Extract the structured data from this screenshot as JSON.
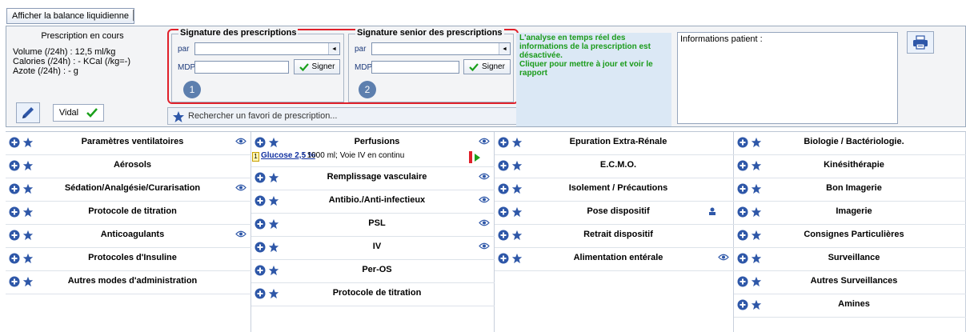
{
  "toolbar": {
    "balance_button": "Afficher la balance liquidienne"
  },
  "prescription": {
    "title": "Prescription en cours",
    "volume": "Volume (/24h) : 12,5 ml/kg",
    "calories": "Calories (/24h) : - KCal (/kg=-)",
    "azote": "Azote (/24h) : - g",
    "vidal_label": "Vidal"
  },
  "signature": {
    "title": "Signature des prescriptions",
    "par_label": "par",
    "par_value": "",
    "mdp_label": "MDP",
    "mdp_value": "",
    "signer_label": "Signer",
    "badge": "1"
  },
  "signature_senior": {
    "title": "Signature senior des prescriptions",
    "par_label": "par",
    "par_value": "",
    "mdp_label": "MDP",
    "mdp_value": "",
    "signer_label": "Signer",
    "badge": "2"
  },
  "favorite_search": {
    "placeholder": "Rechercher un favori de prescription..."
  },
  "analysis": {
    "line1": "L'analyse en temps réel des informations de la prescription est désactivée.",
    "line2": "Cliquer pour mettre à jour et voir le rapport"
  },
  "patient_info": {
    "label": "Informations patient :"
  },
  "columns": [
    {
      "rows": [
        {
          "title": "Paramètres ventilatoires",
          "eye": true
        },
        {
          "title": "Aérosols",
          "eye": false
        },
        {
          "title": "Sédation/Analgésie/Curarisation",
          "eye": true
        },
        {
          "title": "Protocole de titration",
          "eye": false
        },
        {
          "title": "Anticoagulants",
          "eye": true
        },
        {
          "title": "Protocoles d'Insuline",
          "eye": false
        },
        {
          "title": "Autres modes d'administration",
          "eye": false
        }
      ]
    },
    {
      "rows": [
        {
          "title": "Perfusions",
          "eye": true
        },
        {
          "title": "Remplissage vasculaire",
          "eye": true
        },
        {
          "title": "Antibio./Anti-infectieux",
          "eye": true
        },
        {
          "title": "PSL",
          "eye": true
        },
        {
          "title": "IV",
          "eye": true
        },
        {
          "title": "Per-OS",
          "eye": false
        },
        {
          "title": "Protocole de titration",
          "eye": false
        }
      ],
      "perfusion_item": {
        "index": "1",
        "drug": "Glucose 2,5 %",
        "details": " : 1000 ml; Voie IV  en continu"
      }
    },
    {
      "rows": [
        {
          "title": "Epuration Extra-Rénale",
          "eye": false
        },
        {
          "title": "E.C.M.O.",
          "eye": false
        },
        {
          "title": "Isolement / Précautions",
          "eye": false
        },
        {
          "title": "Pose dispositif",
          "eye": false
        },
        {
          "title": "Retrait dispositif",
          "eye": false
        },
        {
          "title": "Alimentation entérale",
          "eye": true
        }
      ]
    },
    {
      "rows": [
        {
          "title": "Biologie / Bactériologie.",
          "eye": false
        },
        {
          "title": "Kinésithérapie",
          "eye": false
        },
        {
          "title": "Bon Imagerie",
          "eye": false
        },
        {
          "title": "Imagerie",
          "eye": false
        },
        {
          "title": "Consignes Particulières",
          "eye": false
        },
        {
          "title": "Surveillance",
          "eye": false
        },
        {
          "title": "Autres Surveillances",
          "eye": false
        },
        {
          "title": "Amines",
          "eye": false
        }
      ]
    }
  ],
  "colors": {
    "accent_blue": "#2e57a8",
    "highlight_red": "#e0202a",
    "analysis_green": "#1a9b1a"
  }
}
